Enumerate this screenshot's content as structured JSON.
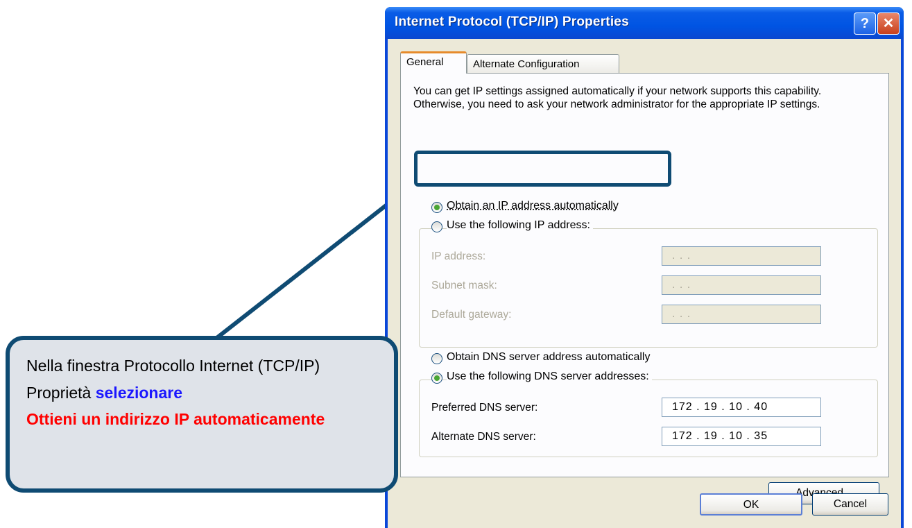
{
  "dialog": {
    "title": "Internet Protocol (TCP/IP) Properties",
    "help_glyph": "?",
    "close_glyph": "✕",
    "tabs": [
      {
        "label": "General",
        "active": true
      },
      {
        "label": "Alternate Configuration",
        "active": false
      }
    ],
    "info_text": "You can get IP settings assigned automatically if your network supports this capability. Otherwise, you need to ask your network administrator for the appropriate IP settings.",
    "ip_mode": {
      "auto_label": "Obtain an IP address automatically",
      "manual_label": "Use the following IP address:",
      "selected": "auto"
    },
    "ip_fields": {
      "ip_address_label": "IP address:",
      "subnet_mask_label": "Subnet mask:",
      "default_gateway_label": "Default gateway:",
      "ip_address_value": ".       .       .",
      "subnet_mask_value": ".       .       .",
      "default_gateway_value": ".       .       ."
    },
    "dns_mode": {
      "auto_label": "Obtain DNS server address automatically",
      "manual_label": "Use the following DNS server addresses:",
      "selected": "manual"
    },
    "dns_fields": {
      "preferred_label": "Preferred DNS server:",
      "alternate_label": "Alternate DNS server:",
      "preferred_value": "172 .  19  .  10  .  40",
      "alternate_value": "172 .  19  .  10  .  35"
    },
    "buttons": {
      "advanced": "Advanced...",
      "ok": "OK",
      "cancel": "Cancel"
    }
  },
  "callout": {
    "text_plain": "Nella finestra Protocollo Internet (TCP/IP) Proprietà ",
    "text_blue": "selezionare",
    "text_red": "Ottieni un indirizzo IP automaticamente",
    "color_blue": "#1b17ff",
    "color_red": "#ff0000",
    "border_color": "#0f4b73"
  }
}
